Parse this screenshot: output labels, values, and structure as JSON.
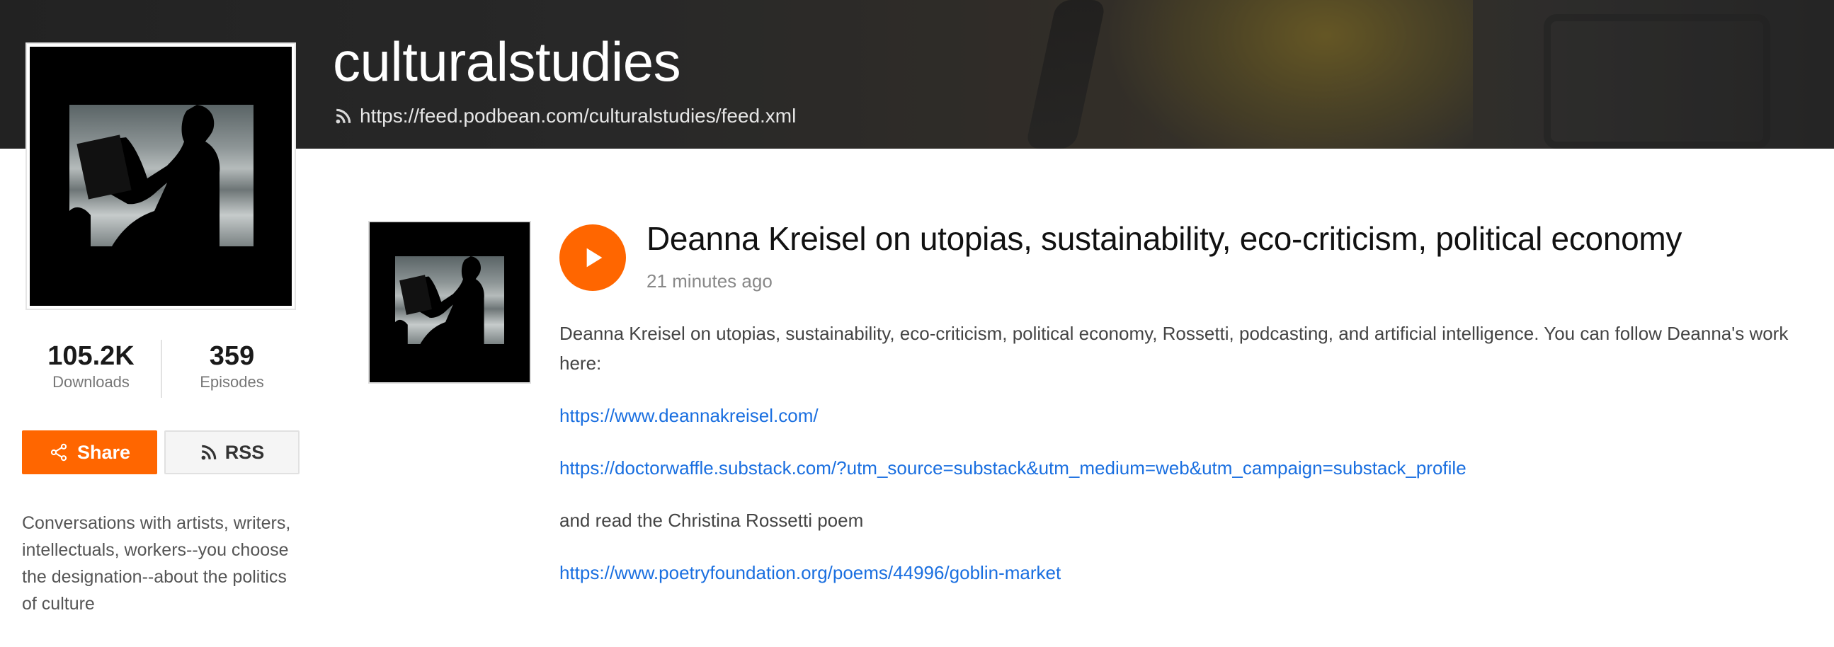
{
  "header": {
    "channel_title": "culturalstudies",
    "feed_url": "https://feed.podbean.com/culturalstudies/feed.xml",
    "feed_icon": "rss-icon"
  },
  "sidebar": {
    "stats": [
      {
        "value": "105.2K",
        "label": "Downloads"
      },
      {
        "value": "359",
        "label": "Episodes"
      }
    ],
    "share_label": "Share",
    "share_icon": "share-icon",
    "rss_label": "RSS",
    "rss_icon": "rss-icon",
    "description": "Conversations with artists, writers, intellectuals, workers--you choose the designation--about the politics of culture"
  },
  "episode": {
    "title": "Deanna Kreisel on utopias, sustainability, eco-criticism, political economy",
    "time_ago": "21 minutes ago",
    "play_icon": "play-icon",
    "intro": "Deanna Kreisel on utopias, sustainability, eco-criticism, political economy, Rossetti, podcasting, and artificial intelligence. You can follow Deanna's work here:",
    "link1": "https://www.deannakreisel.com/",
    "link2": "https://doctorwaffle.substack.com/?utm_source=substack&utm_medium=web&utm_campaign=substack_profile",
    "mid_text": "and read the Christina Rossetti poem",
    "link3": "https://www.poetryfoundation.org/poems/44996/goblin-market"
  },
  "colors": {
    "accent": "#ff6600",
    "link": "#1a6fe0",
    "banner": "#2f2f2f"
  }
}
